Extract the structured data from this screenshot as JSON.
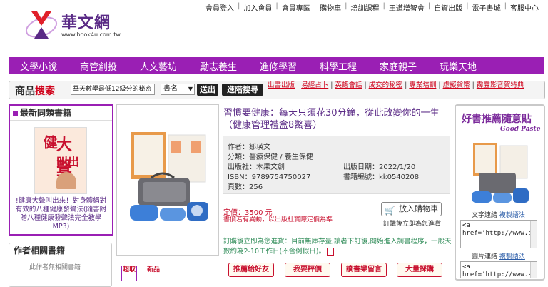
{
  "header": {
    "logo_text": "華文網",
    "logo_url": "www.book4u.com.tw",
    "toplinks": [
      "會員登入",
      "加入會員",
      "會員專區",
      "購物車",
      "培訓課程",
      "王道增智會",
      "自資出版",
      "電子書城",
      "客服中心"
    ]
  },
  "nav": [
    "文學小說",
    "商管創投",
    "人文藝坊",
    "勵志養生",
    "進修學習",
    "科學工程",
    "家庭親子",
    "玩樂天地"
  ],
  "search": {
    "title_a": "商品",
    "title_b": "搜索",
    "input_value": "華天數學最低12級分的秘密",
    "select_value": "書名",
    "send_label": "送出",
    "advanced_label": "進階搜尋",
    "quicklinks": [
      "出書出版",
      "易經占卜",
      "英語會話",
      "成交的秘密",
      "專業培訓",
      "虛擬貨幣",
      "霹靂影音賀特典"
    ]
  },
  "left": {
    "header": "最新同類書籍",
    "book_title_a": "健",
    "book_title_b": "大聲",
    "book_title_c": "叫出來!",
    "book_desc": "!健康大聲叫出來！對身體絹對有效的八種健康發聲法(隨書附贈八種健康發聲法完全教學MP3)",
    "header2": "作者相關書籍",
    "sub2": "此作者無相關書籍"
  },
  "product": {
    "title": "習慣要健康：每天只須花30分鐘，從此改變你的一生（健康管理禮盒8鱉喜）",
    "author_label": "作者：",
    "author": "鄒瑛文",
    "category_label": "分類：",
    "category": "醫療保健 / 養生保健",
    "publisher_label": "出版社：",
    "publisher": "木果文創",
    "pubdate_label": "出版日期：",
    "pubdate": "2022/1/20",
    "isbn_label": "ISBN：",
    "isbn": "9789754750027",
    "code_label": "書籍編號：",
    "code": "kk0540208",
    "pages_label": "頁數：",
    "pages": "256",
    "price_label": "定價：",
    "price": "3500 元",
    "price_note": "書價若有異動，以出版社實際定價為準",
    "cart_label": "放入購物車",
    "order_note": "訂購後立即為您進貨",
    "notice": "訂購後立即為您進貨：目前無庫存量,讀者下訂後,開始進入調書程序，一般天數約為2-10工作日(不含例假日)。",
    "badge1": "超取",
    "badge2": "新品",
    "actions": [
      "推薦給好友",
      "我要評價",
      "讀書樂留言",
      "大量採購"
    ]
  },
  "right": {
    "title": "好書推薦隨意貼",
    "subtitle": "Good Paste",
    "text_link_label": "文字連結",
    "text_link_syntax": "複製語法",
    "text_code": "<a href='http://www.silkbook.com/book_det",
    "img_link_label": "圖片連結",
    "img_link_syntax": "複製語法",
    "img_code": "<a href='http://www.sil"
  },
  "colors": {
    "purple": "#9a1fb4",
    "red": "#c8102e",
    "green": "#2e8b57"
  }
}
